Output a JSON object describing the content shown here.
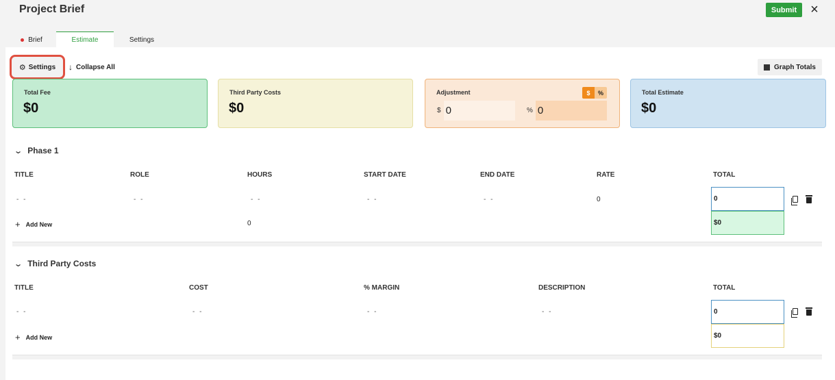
{
  "header": {
    "title": "Project Brief",
    "submit_label": "Submit",
    "close_icon": "×"
  },
  "tabs": [
    {
      "label": "Brief",
      "has_dot": true
    },
    {
      "label": "Estimate",
      "active": true
    },
    {
      "label": "Settings"
    }
  ],
  "toolbar": {
    "settings_label": "Settings",
    "collapse_label": "Collapse All",
    "graph_label": "Graph Totals"
  },
  "cards": {
    "total_fee": {
      "label": "Total Fee",
      "value": "$0"
    },
    "third_party": {
      "label": "Third Party Costs",
      "value": "$0"
    },
    "adjustment": {
      "label": "Adjustment",
      "toggle_dollar": "$",
      "toggle_percent": "%",
      "dollar_symbol": "$",
      "dollar_value": "0",
      "percent_symbol": "%",
      "percent_value": "0"
    },
    "total_estimate": {
      "label": "Total Estimate",
      "value": "$0"
    }
  },
  "phase1": {
    "title": "Phase 1",
    "columns": [
      "TITLE",
      "ROLE",
      "HOURS",
      "START DATE",
      "END DATE",
      "RATE",
      "TOTAL"
    ],
    "row": {
      "title": "- -",
      "role": "- -",
      "hours": "- -",
      "start_date": "- -",
      "end_date": "- -",
      "rate": "0",
      "total": "0"
    },
    "add_label": "Add New",
    "hours_total": "0",
    "sum": "$0"
  },
  "third_party_costs": {
    "title": "Third Party Costs",
    "columns": [
      "TITLE",
      "COST",
      "% MARGIN",
      "DESCRIPTION",
      "TOTAL"
    ],
    "row": {
      "title": "- -",
      "cost": "- -",
      "margin": "- -",
      "description": "- -",
      "total": "0"
    },
    "add_label": "Add New",
    "sum": "$0"
  },
  "colors": {
    "accent": "#2e9e3e",
    "highlight": "#e05040"
  }
}
